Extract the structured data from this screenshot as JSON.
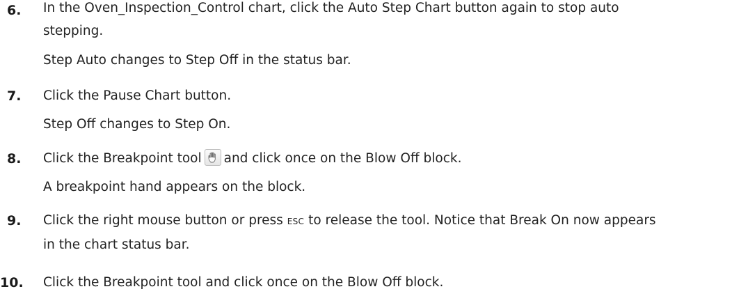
{
  "steps": [
    {
      "number": "6.",
      "lines": [
        "In the Oven_Inspection_Control chart, click the Auto Step Chart button again to stop auto",
        "stepping."
      ],
      "result": "Step Auto changes to Step Off in the status bar."
    },
    {
      "number": "7.",
      "text": "Click the Pause Chart button.",
      "result": "Step Off changes to Step On."
    },
    {
      "number": "8.",
      "before_icon": "Click the Breakpoint tool",
      "after_icon": "and click once on the Blow Off block.",
      "icon": "hand-breakpoint-icon",
      "result": "A breakpoint hand appears on the block."
    },
    {
      "number": "9.",
      "before_key": "Click the right mouse button or press",
      "key": "ESC",
      "after_key": "to release the tool. Notice that Break On now appears",
      "line2": "in the chart status bar."
    },
    {
      "number": "10.",
      "text": "Click the Breakpoint tool and click once on the Blow Off block."
    }
  ]
}
